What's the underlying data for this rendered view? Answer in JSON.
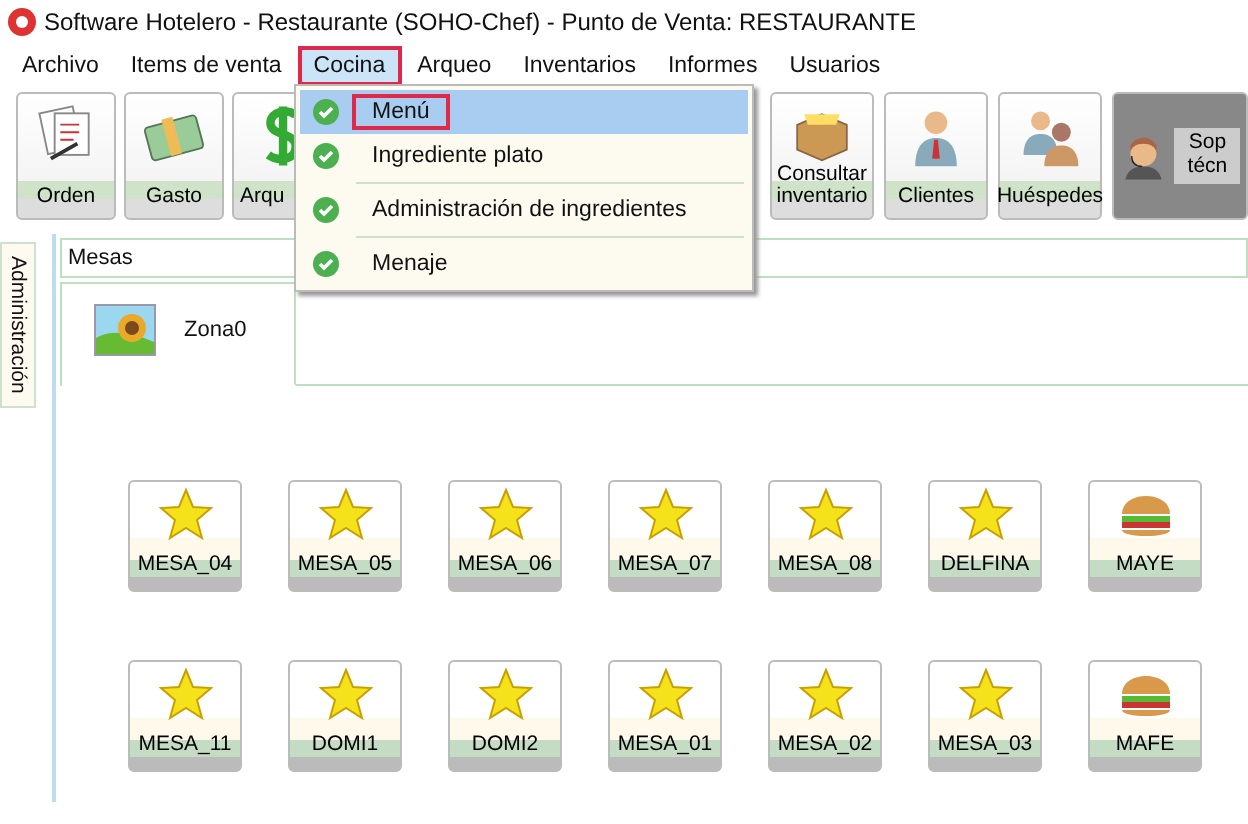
{
  "window": {
    "title": "Software  Hotelero - Restaurante (SOHO-Chef)  - Punto de Venta: RESTAURANTE"
  },
  "menu_bar": [
    {
      "label": "Archivo",
      "selected": false,
      "annotated": false
    },
    {
      "label": "Items de venta",
      "selected": false,
      "annotated": false
    },
    {
      "label": "Cocina",
      "selected": true,
      "annotated": true
    },
    {
      "label": "Arqueo",
      "selected": false,
      "annotated": false
    },
    {
      "label": "Inventarios",
      "selected": false,
      "annotated": false
    },
    {
      "label": "Informes",
      "selected": false,
      "annotated": false
    },
    {
      "label": "Usuarios",
      "selected": false,
      "annotated": false
    }
  ],
  "dropdown": [
    {
      "kind": "item",
      "label": "Menú",
      "selected": true,
      "annotated": true
    },
    {
      "kind": "item",
      "label": "Ingrediente plato",
      "selected": false,
      "annotated": false
    },
    {
      "kind": "separator"
    },
    {
      "kind": "item",
      "label": "Administración de ingredientes",
      "selected": false,
      "annotated": false
    },
    {
      "kind": "separator"
    },
    {
      "kind": "item",
      "label": "Menaje",
      "selected": false,
      "annotated": false
    }
  ],
  "toolbar_left": [
    {
      "kind": "notes",
      "label": "Orden"
    },
    {
      "kind": "money",
      "label": "Gasto"
    },
    {
      "kind": "dollar",
      "label": "Arqu"
    }
  ],
  "toolbar_right": [
    {
      "kind": "box",
      "label": "Consultar inventario"
    },
    {
      "kind": "person",
      "label": "Clientes"
    },
    {
      "kind": "people",
      "label": "Huéspedes"
    },
    {
      "kind": "support",
      "label": "Sop técn"
    }
  ],
  "side_tabs": [
    {
      "label": "Administración",
      "selected": true
    }
  ],
  "panel": {
    "title": "Mesas",
    "zone_tabs": [
      {
        "label": "Zona0",
        "selected": true
      }
    ],
    "tables": [
      {
        "label": "MESA_04",
        "kind": "star"
      },
      {
        "label": "MESA_05",
        "kind": "star"
      },
      {
        "label": "MESA_06",
        "kind": "star"
      },
      {
        "label": "MESA_07",
        "kind": "star"
      },
      {
        "label": "MESA_08",
        "kind": "star"
      },
      {
        "label": "DELFINA",
        "kind": "star"
      },
      {
        "label": "MAYE",
        "kind": "burger"
      },
      {
        "label": "MESA_11",
        "kind": "star"
      },
      {
        "label": "DOMI1",
        "kind": "star"
      },
      {
        "label": "DOMI2",
        "kind": "star"
      },
      {
        "label": "MESA_01",
        "kind": "star"
      },
      {
        "label": "MESA_02",
        "kind": "star"
      },
      {
        "label": "MESA_03",
        "kind": "star"
      },
      {
        "label": "MAFE",
        "kind": "burger"
      }
    ]
  }
}
